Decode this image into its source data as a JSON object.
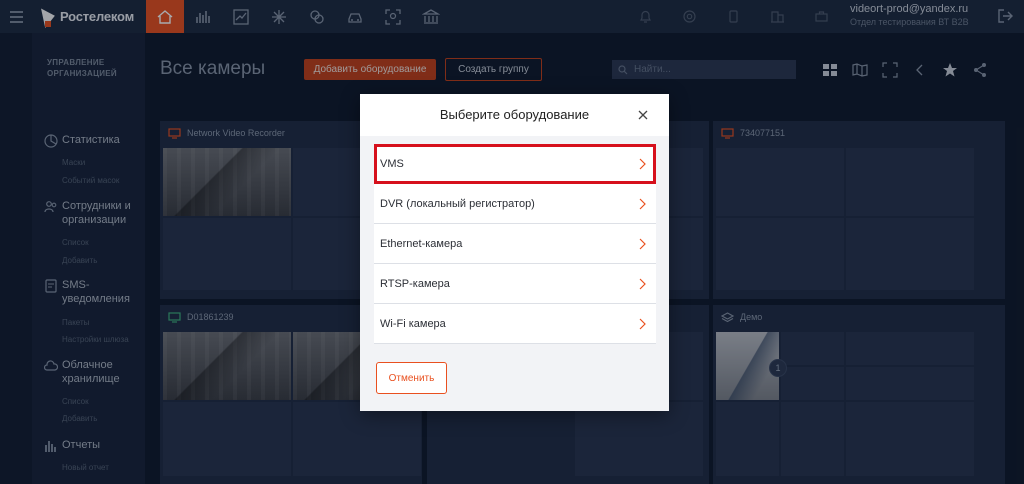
{
  "header": {
    "brand": "Ростелеком",
    "user_email": "videort-prod@yandex.ru",
    "user_dept": "Отдел тестирования ВТ B2B"
  },
  "sidebar": {
    "section_title_1": "УПРАВЛЕНИЕ",
    "section_title_2": "ОРГАНИЗАЦИЕЙ",
    "items": [
      {
        "label": "Статистика",
        "subs": [
          "Маски",
          "Событий масок"
        ]
      },
      {
        "label_1": "Сотрудники и",
        "label_2": "организации",
        "subs": [
          "Список",
          "Добавить"
        ]
      },
      {
        "label_1": "SMS-",
        "label_2": "уведомления",
        "subs": [
          "Пакеты",
          "Настройки шлюза"
        ]
      },
      {
        "label_1": "Облачное",
        "label_2": "хранилище",
        "subs": [
          "Список",
          "Добавить"
        ]
      },
      {
        "label": "Отчеты",
        "subs": [
          "Новый отчет"
        ]
      }
    ]
  },
  "main": {
    "title": "Все камеры",
    "add_button": "Добавить оборудование",
    "group_button": "Создать группу",
    "search_placeholder": "Найти..."
  },
  "tiles": [
    {
      "name": "Network Video Recorder"
    },
    {
      "name": "734077151"
    },
    {
      "name": "D01861239"
    },
    {
      "name": "Демо",
      "badge": "1"
    }
  ],
  "modal": {
    "title": "Выберите оборудование",
    "options": [
      "VMS",
      "DVR (локальный регистратор)",
      "Ethernet-камера",
      "RTSP-камера",
      "Wi-Fi камера"
    ],
    "selected_index": 0,
    "cancel_label": "Отменить"
  },
  "colors": {
    "accent": "#e9501f",
    "highlight": "#d6101c",
    "topbar": "#1c2a40"
  }
}
